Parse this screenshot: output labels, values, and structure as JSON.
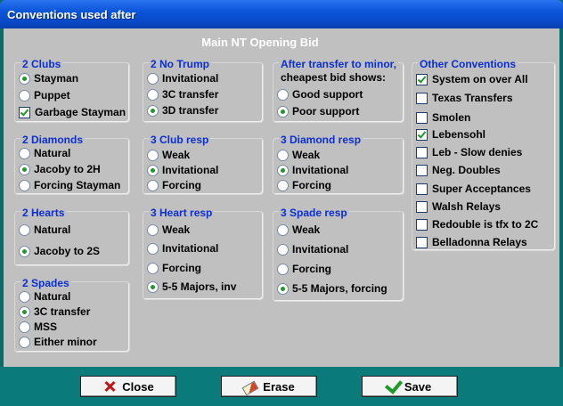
{
  "window": {
    "title": "Conventions used after"
  },
  "heading": "Main NT Opening Bid",
  "groups": {
    "clubs2": {
      "title": "2 Clubs",
      "opts": [
        "Stayman",
        "Puppet",
        "Garbage Stayman"
      ]
    },
    "nt2": {
      "title": "2 No Trump",
      "opts": [
        "Invitational",
        "3C transfer",
        "3D transfer"
      ]
    },
    "after_transfer": {
      "title1": "After transfer to minor,",
      "title2": "cheapest bid shows:",
      "opts": [
        "Good support",
        "Poor support"
      ]
    },
    "other": {
      "title": "Other Conventions",
      "opts": [
        "System on over All",
        "Texas Transfers",
        "Smolen",
        "Lebensohl",
        "Leb - Slow denies",
        "Neg. Doubles",
        "Super Acceptances",
        "Walsh Relays",
        "Redouble is tfx to 2C",
        "Belladonna Relays"
      ]
    },
    "diamonds2": {
      "title": "2 Diamonds",
      "opts": [
        "Natural",
        "Jacoby to 2H",
        "Forcing Stayman"
      ]
    },
    "club3": {
      "title": "3 Club resp",
      "opts": [
        "Weak",
        "Invitational",
        "Forcing"
      ]
    },
    "diamond3": {
      "title": "3 Diamond resp",
      "opts": [
        "Weak",
        "Invitational",
        "Forcing"
      ]
    },
    "hearts2": {
      "title": "2 Hearts",
      "opts": [
        "Natural",
        "Jacoby to 2S"
      ]
    },
    "heart3": {
      "title": "3 Heart resp",
      "opts": [
        "Weak",
        "Invitational",
        "Forcing",
        "5-5 Majors, inv"
      ]
    },
    "spade3": {
      "title": "3 Spade resp",
      "opts": [
        "Weak",
        "Invitational",
        "Forcing",
        "5-5 Majors, forcing"
      ]
    },
    "spades2": {
      "title": "2 Spades",
      "opts": [
        "Natural",
        "3C transfer",
        "MSS",
        "Either minor"
      ]
    }
  },
  "buttons": {
    "close": "Close",
    "erase": "Erase",
    "save": "Save"
  }
}
